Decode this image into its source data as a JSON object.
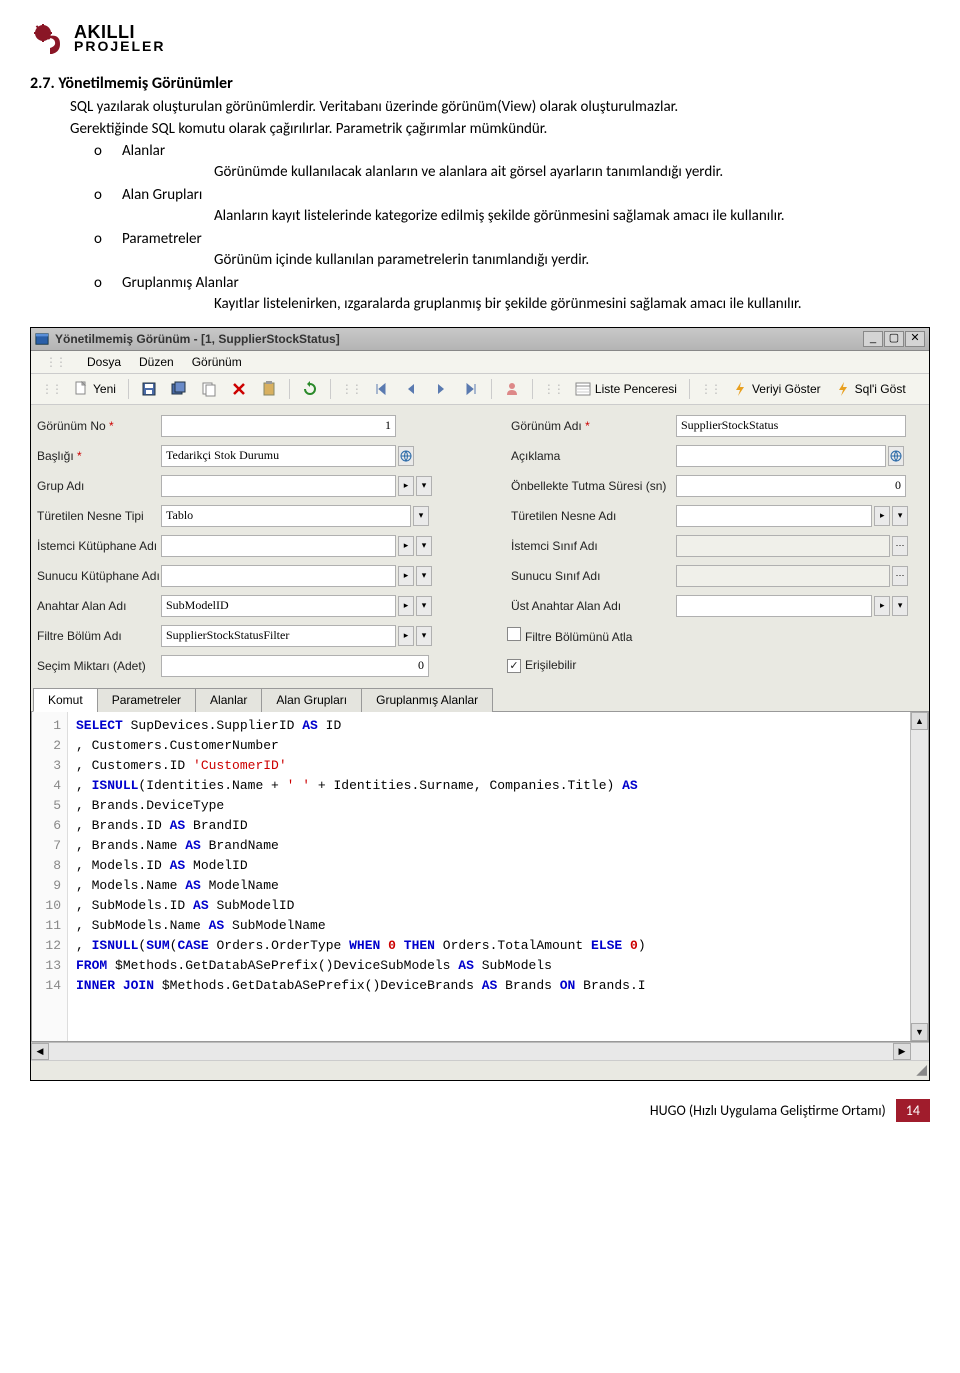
{
  "logo": {
    "line1": "AKILLI",
    "line2": "PROJELER"
  },
  "section": {
    "heading": "2.7. Yönetilmemiş Görünümler",
    "p1": "SQL yazılarak oluşturulan görünümlerdir. Veritabanı üzerinde görünüm(View) olarak oluşturulmazlar.",
    "p2": "Gerektiğinde SQL komutu olarak çağırılırlar. Parametrik çağırımlar mümkündür.",
    "bullets": [
      {
        "label": "Alanlar",
        "desc": "Görünümde kullanılacak alanların ve alanlara ait görsel ayarların tanımlandığı yerdir."
      },
      {
        "label": "Alan Grupları",
        "desc": "Alanların kayıt listelerinde kategorize edilmiş şekilde görünmesini sağlamak amacı ile kullanılır."
      },
      {
        "label": "Parametreler",
        "desc": "Görünüm içinde kullanılan parametrelerin tanımlandığı yerdir."
      },
      {
        "label": "Gruplanmış Alanlar",
        "desc": "Kayıtlar listelenirken, ızgaralarda gruplanmış bir şekilde görünmesini sağlamak amacı ile kullanılır."
      }
    ]
  },
  "win": {
    "title": "Yönetilmemiş Görünüm - [1, SupplierStockStatus]",
    "menu": {
      "file": "Dosya",
      "edit": "Düzen",
      "view": "Görünüm"
    },
    "toolbar": {
      "new": "Yeni",
      "listWindow": "Liste Penceresi",
      "showData": "Veriyi Göster",
      "showSql": "Sql'i Göst"
    },
    "form": {
      "gorunumNo": {
        "label": "Görünüm No",
        "value": "1"
      },
      "gorunumAdi": {
        "label": "Görünüm Adı",
        "value": "SupplierStockStatus"
      },
      "basligi": {
        "label": "Başlığı",
        "value": "Tedarikçi Stok Durumu"
      },
      "aciklama": {
        "label": "Açıklama",
        "value": ""
      },
      "grupAdi": {
        "label": "Grup Adı",
        "value": ""
      },
      "onbellek": {
        "label": "Önbellekte Tutma Süresi (sn)",
        "value": "0"
      },
      "turetilenTip": {
        "label": "Türetilen Nesne Tipi",
        "value": "Tablo"
      },
      "turetilenAdi": {
        "label": "Türetilen Nesne Adı",
        "value": ""
      },
      "istemciKutuphane": {
        "label": "İstemci Kütüphane Adı",
        "value": ""
      },
      "istemciSinif": {
        "label": "İstemci Sınıf Adı",
        "value": ""
      },
      "sunucuKutuphane": {
        "label": "Sunucu Kütüphane Adı",
        "value": ""
      },
      "sunucuSinif": {
        "label": "Sunucu Sınıf Adı",
        "value": ""
      },
      "anahtarAlan": {
        "label": "Anahtar Alan Adı",
        "value": "SubModelID"
      },
      "ustAnahtarAlan": {
        "label": "Üst Anahtar Alan Adı",
        "value": ""
      },
      "filtreBolum": {
        "label": "Filtre Bölüm Adı",
        "value": "SupplierStockStatusFilter"
      },
      "filtreAtla": {
        "label": "Filtre Bölümünü Atla",
        "checked": false
      },
      "secimMiktari": {
        "label": "Seçim Miktarı (Adet)",
        "value": "0"
      },
      "erisilebilir": {
        "label": "Erişilebilir",
        "checked": true
      }
    },
    "tabs": {
      "komut": "Komut",
      "parametreler": "Parametreler",
      "alanlar": "Alanlar",
      "alanGruplari": "Alan Grupları",
      "gruplanmis": "Gruplanmış Alanlar"
    },
    "code": [
      "SELECT SupDevices.SupplierID AS ID",
      ", Customers.CustomerNumber",
      ", Customers.ID 'CustomerID'",
      ", ISNULL(Identities.Name + ' ' + Identities.Surname, Companies.Title) AS",
      ", Brands.DeviceType",
      ", Brands.ID AS BrandID",
      ", Brands.Name AS BrandName",
      ", Models.ID AS ModelID",
      ", Models.Name AS ModelName",
      ", SubModels.ID AS SubModelID",
      ", SubModels.Name AS SubModelName",
      ", ISNULL(SUM(CASE Orders.OrderType WHEN 0 THEN Orders.TotalAmount ELSE 0)",
      "FROM $Methods.GetDatabASePrefix()DeviceSubModels AS SubModels",
      "INNER JOIN $Methods.GetDatabASePrefix()DeviceBrands AS Brands ON Brands.I"
    ]
  },
  "footer": {
    "text": "HUGO (Hızlı Uygulama Geliştirme Ortamı)",
    "page": "14"
  }
}
